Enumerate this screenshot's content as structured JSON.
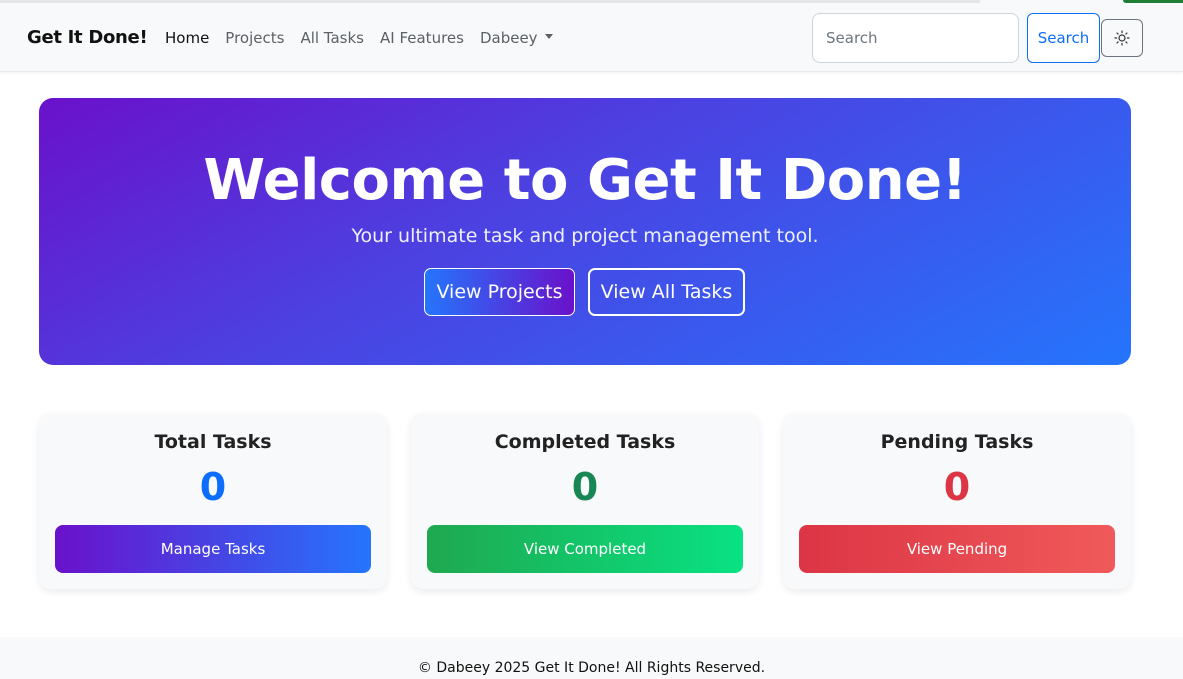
{
  "nav": {
    "brand": "Get It Done!",
    "links": [
      "Home",
      "Projects",
      "All Tasks",
      "AI Features",
      "Dabeey"
    ],
    "search_placeholder": "Search",
    "search_button": "Search",
    "theme_icon": "sun-icon"
  },
  "hero": {
    "title": "Welcome to Get It Done!",
    "subtitle": "Your ultimate task and project management tool.",
    "btn_projects": "View Projects",
    "btn_tasks": "View All Tasks"
  },
  "stats": [
    {
      "title": "Total Tasks",
      "value": "0",
      "button": "Manage Tasks",
      "color": "#0d6efd"
    },
    {
      "title": "Completed Tasks",
      "value": "0",
      "button": "View Completed",
      "color": "#198754"
    },
    {
      "title": "Pending Tasks",
      "value": "0",
      "button": "View Pending",
      "color": "#dc3545"
    }
  ],
  "footer": {
    "text": "© Dabeey 2025 Get It Done! All Rights Reserved."
  },
  "colors": {
    "hero_start": "#6a11cb",
    "hero_end": "#2575fc",
    "primary": "#0d6efd",
    "success": "#198754",
    "danger": "#dc3545"
  }
}
